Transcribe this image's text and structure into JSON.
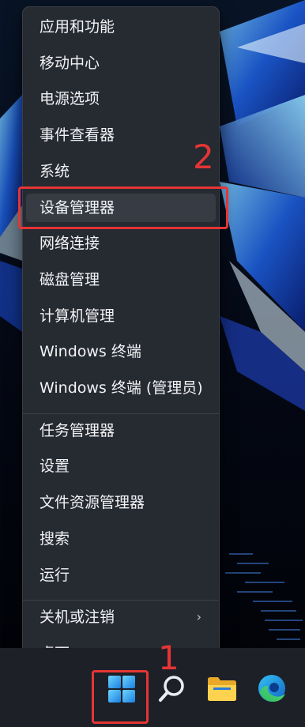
{
  "context_menu": {
    "groups": [
      [
        "应用和功能",
        "移动中心",
        "电源选项",
        "事件查看器",
        "系统",
        "设备管理器",
        "网络连接",
        "磁盘管理",
        "计算机管理",
        "Windows 终端",
        "Windows 终端 (管理员)"
      ],
      [
        "任务管理器",
        "设置",
        "文件资源管理器",
        "搜索",
        "运行"
      ],
      [
        "关机或注销",
        "桌面"
      ]
    ],
    "highlighted_item": "设备管理器",
    "submenu_arrow": "›"
  },
  "annotations": {
    "step_1": "1",
    "step_2": "2",
    "highlight_color": "#e53535"
  },
  "taskbar": {
    "icons": [
      "windows-start-icon",
      "search-icon",
      "file-explorer-icon",
      "edge-browser-icon"
    ]
  },
  "colors": {
    "menu_background": "#262a31",
    "menu_text": "#f2f3f5",
    "taskbar_background": "#1d2027",
    "accent_blue": "#0078d4"
  }
}
